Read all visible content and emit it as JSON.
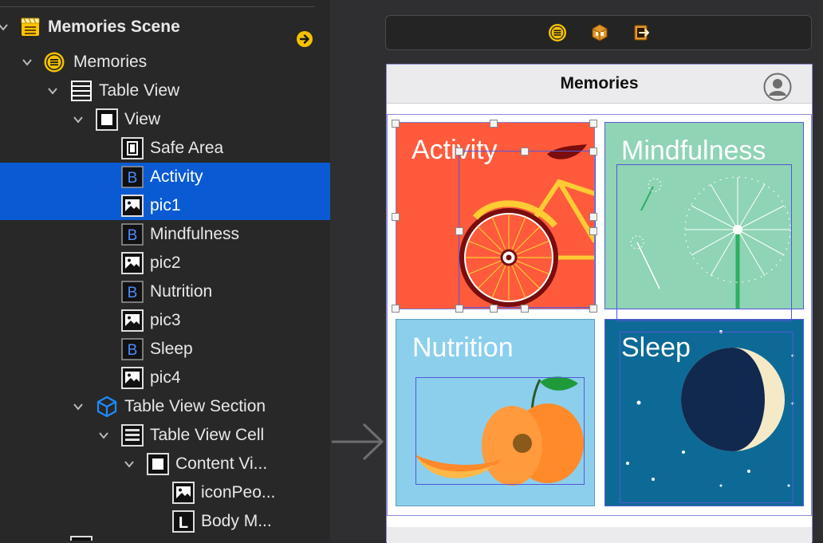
{
  "outline": {
    "scene_title": "Memories Scene",
    "items": [
      {
        "label": "Memories",
        "icon": "view-controller-icon"
      },
      {
        "label": "Table View",
        "icon": "table-view-icon"
      },
      {
        "label": "View",
        "icon": "view-icon"
      },
      {
        "label": "Safe Area",
        "icon": "safe-area-icon"
      },
      {
        "label": "Activity",
        "icon": "button-icon"
      },
      {
        "label": "pic1",
        "icon": "image-icon"
      },
      {
        "label": "Mindfulness",
        "icon": "button-icon"
      },
      {
        "label": "pic2",
        "icon": "image-icon"
      },
      {
        "label": "Nutrition",
        "icon": "button-icon"
      },
      {
        "label": "pic3",
        "icon": "image-icon"
      },
      {
        "label": "Sleep",
        "icon": "button-icon"
      },
      {
        "label": "pic4",
        "icon": "image-icon"
      },
      {
        "label": "Table View Section",
        "icon": "cube-icon"
      },
      {
        "label": "Table View Cell",
        "icon": "table-view-icon"
      },
      {
        "label": "Content Vi...",
        "icon": "view-icon"
      },
      {
        "label": "iconPeo...",
        "icon": "image-icon"
      },
      {
        "label": "Body M...",
        "icon": "label-icon"
      }
    ],
    "button_glyph": "B",
    "label_glyph": "L"
  },
  "canvas": {
    "nav_title": "Memories",
    "tiles": {
      "activity": "Activity",
      "mindfulness": "Mindfulness",
      "nutrition": "Nutrition",
      "sleep": "Sleep"
    }
  },
  "colors": {
    "selection": "#0a5bd3",
    "accent_yellow": "#f5c200",
    "activity": "#ff5a3c",
    "mindfulness": "#8fd4b4",
    "nutrition": "#8ccfec",
    "sleep": "#0d6a96"
  }
}
